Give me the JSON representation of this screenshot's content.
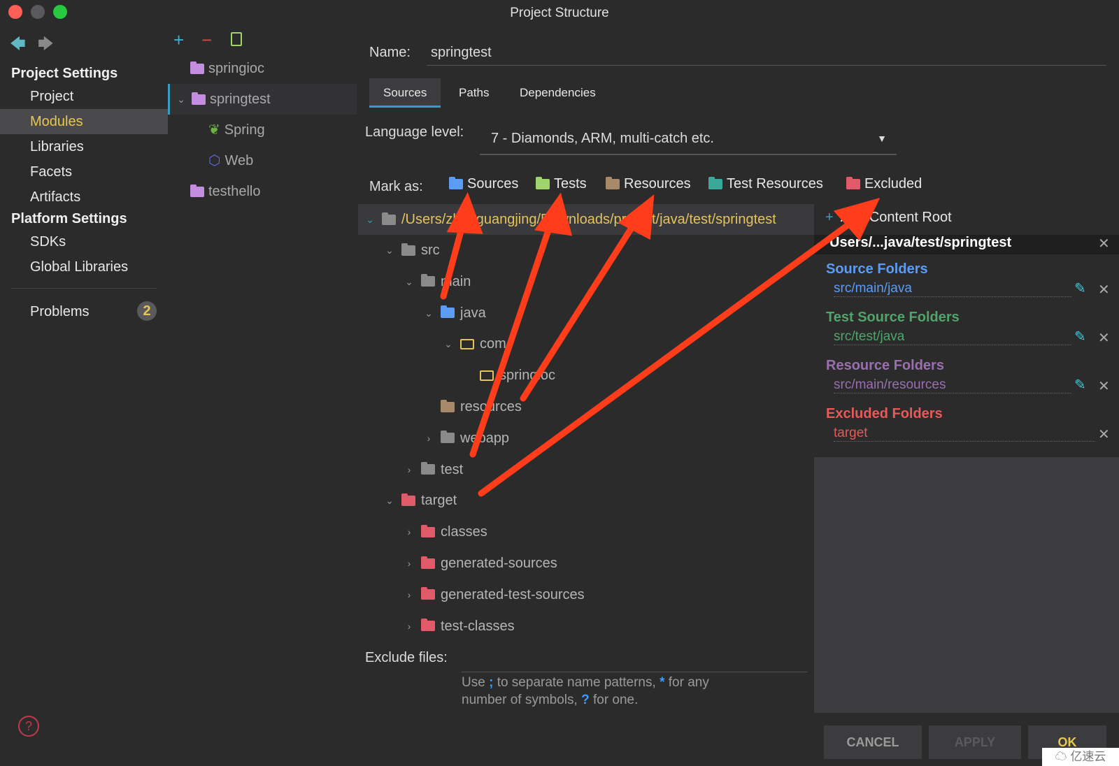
{
  "window": {
    "title": "Project Structure"
  },
  "sidebar": {
    "project_settings": "Project Settings",
    "items": [
      {
        "label": "Project"
      },
      {
        "label": "Modules"
      },
      {
        "label": "Libraries"
      },
      {
        "label": "Facets"
      },
      {
        "label": "Artifacts"
      }
    ],
    "platform_settings": "Platform Settings",
    "platform_items": [
      {
        "label": "SDKs"
      },
      {
        "label": "Global Libraries"
      }
    ],
    "problems": {
      "label": "Problems",
      "count": "2"
    }
  },
  "modules": [
    {
      "label": "springioc"
    },
    {
      "label": "springtest"
    },
    {
      "label": "Spring"
    },
    {
      "label": "Web"
    },
    {
      "label": "testhello"
    }
  ],
  "main": {
    "name_label": "Name:",
    "name_value": "springtest",
    "tabs": [
      {
        "label": "Sources"
      },
      {
        "label": "Paths"
      },
      {
        "label": "Dependencies"
      }
    ],
    "language_label": "Language level:",
    "language_value": "7 - Diamonds, ARM, multi-catch etc.",
    "mark_as": "Mark as:",
    "marks": [
      {
        "label": "Sources",
        "color": "#5c9cf5"
      },
      {
        "label": "Tests",
        "color": "#9fd36b"
      },
      {
        "label": "Resources",
        "color": "#a88a6a"
      },
      {
        "label": "Test Resources",
        "color": "#3aa89a"
      },
      {
        "label": "Excluded",
        "color": "#e05a6a"
      }
    ],
    "root_path": "/Users/zhaoguangjing/Downloads/project/java/test/springtest",
    "tree": [
      {
        "label": "src",
        "color": "#8a8a8a"
      },
      {
        "label": "main",
        "color": "#8a8a8a"
      },
      {
        "label": "java",
        "color": "#5c9cf5"
      },
      {
        "label": "com",
        "color": "#e5c35b"
      },
      {
        "label": "springioc",
        "color": "#e5c35b"
      },
      {
        "label": "resources",
        "color": "#a88a6a"
      },
      {
        "label": "webapp",
        "color": "#8a8a8a"
      },
      {
        "label": "test",
        "color": "#8a8a8a"
      },
      {
        "label": "target",
        "color": "#e05a6a"
      },
      {
        "label": "classes",
        "color": "#e05a6a"
      },
      {
        "label": "generated-sources",
        "color": "#e05a6a"
      },
      {
        "label": "generated-test-sources",
        "color": "#e05a6a"
      },
      {
        "label": "test-classes",
        "color": "#e05a6a"
      }
    ],
    "exclude_label": "Exclude files:",
    "exclude_hint_1": "Use",
    "exclude_hint_semi": ";",
    "exclude_hint_2": "to separate name patterns,",
    "exclude_hint_star": "*",
    "exclude_hint_3": "for any",
    "exclude_hint_4": "number of symbols,",
    "exclude_hint_q": "?",
    "exclude_hint_5": "for one."
  },
  "right_panel": {
    "add_root": "Add Content Root",
    "root_short": "Users/...java/test/springtest",
    "sections": [
      {
        "title": "Source Folders",
        "path": "src/main/java",
        "color": "#5c9cf5"
      },
      {
        "title": "Test Source Folders",
        "path": "src/test/java",
        "color": "#4fa56a"
      },
      {
        "title": "Resource Folders",
        "path": "src/main/resources",
        "color": "#9a6fb0"
      },
      {
        "title": "Excluded Folders",
        "path": "target",
        "color": "#e85a5a"
      }
    ]
  },
  "buttons": {
    "cancel": "CANCEL",
    "apply": "APPLY",
    "ok": "OK"
  },
  "watermark": "亿速云"
}
